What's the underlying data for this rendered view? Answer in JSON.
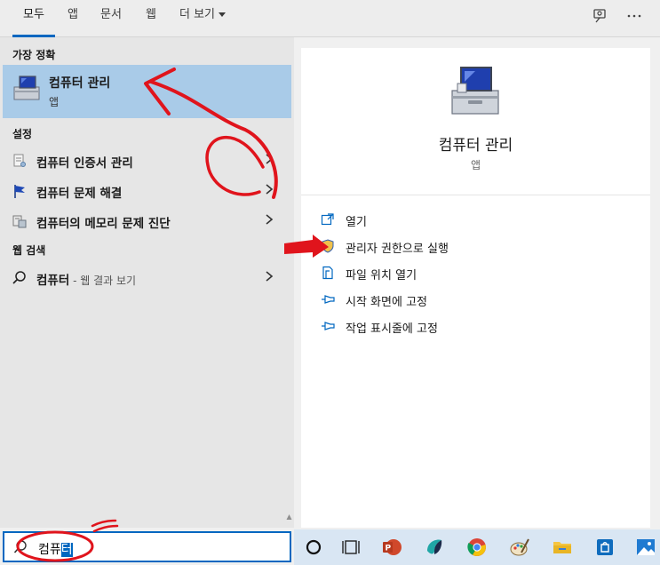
{
  "tabs": [
    {
      "label": "모두",
      "active": true
    },
    {
      "label": "앱"
    },
    {
      "label": "문서"
    },
    {
      "label": "웹"
    },
    {
      "label": "더 보기"
    }
  ],
  "sections": {
    "best_match": "가장 정확",
    "settings": "설정",
    "web_search": "웹 검색"
  },
  "best_match": {
    "title": "컴퓨터 관리",
    "subtitle": "앱"
  },
  "settings_items": [
    {
      "label": "컴퓨터 인증서 관리",
      "icon": "certificate-icon"
    },
    {
      "label": "컴퓨터 문제 해결",
      "icon": "flag-icon"
    },
    {
      "bold": "컴퓨터",
      "rest": "의 메모리 문제 진단",
      "icon": "memory-diagnostic-icon"
    }
  ],
  "web_item": {
    "bold": "컴퓨터",
    "rest": " - 웹 결과 보기",
    "icon": "search-icon"
  },
  "preview": {
    "title": "컴퓨터 관리",
    "subtitle": "앱"
  },
  "actions": [
    {
      "label": "열기",
      "icon": "open-icon"
    },
    {
      "label": "관리자 권한으로 실행",
      "icon": "run-as-admin-icon"
    },
    {
      "label": "파일 위치 열기",
      "icon": "file-location-icon"
    },
    {
      "label": "시작 화면에 고정",
      "icon": "pin-icon"
    },
    {
      "label": "작업 표시줄에 고정",
      "icon": "pin-icon"
    }
  ],
  "search": {
    "typed": "컴퓨",
    "selected": "터"
  },
  "taskbar_icons": [
    "cortana-icon",
    "task-view-icon",
    "powerpoint-icon",
    "app-icon",
    "chrome-icon",
    "paint-icon",
    "file-explorer-icon",
    "store-icon",
    "photos-icon"
  ],
  "colors": {
    "accent": "#0067c0",
    "selection": "#a9cbe8",
    "annotation": "#e0141c"
  }
}
